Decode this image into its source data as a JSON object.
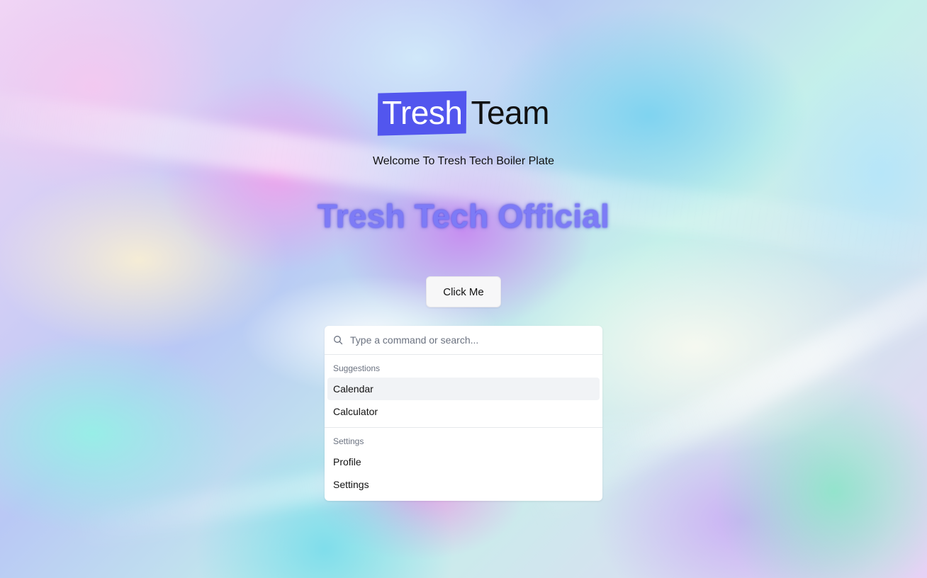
{
  "logo": {
    "highlight_text": "Tresh",
    "plain_text": "Team",
    "highlight_color": "#5256ee"
  },
  "welcome_text": "Welcome To Tresh Tech Boiler Plate",
  "hero_title": "Tresh Tech Official",
  "hero_title_color": "#7d7bf6",
  "cta_button_label": "Click Me",
  "command": {
    "search_icon": "search-icon",
    "placeholder": "Type a command or search...",
    "value": "",
    "groups": [
      {
        "heading": "Suggestions",
        "items": [
          {
            "label": "Calendar",
            "highlighted": true
          },
          {
            "label": "Calculator",
            "highlighted": false
          }
        ]
      },
      {
        "heading": "Settings",
        "items": [
          {
            "label": "Profile",
            "highlighted": false
          },
          {
            "label": "Settings",
            "highlighted": false
          }
        ]
      }
    ]
  }
}
